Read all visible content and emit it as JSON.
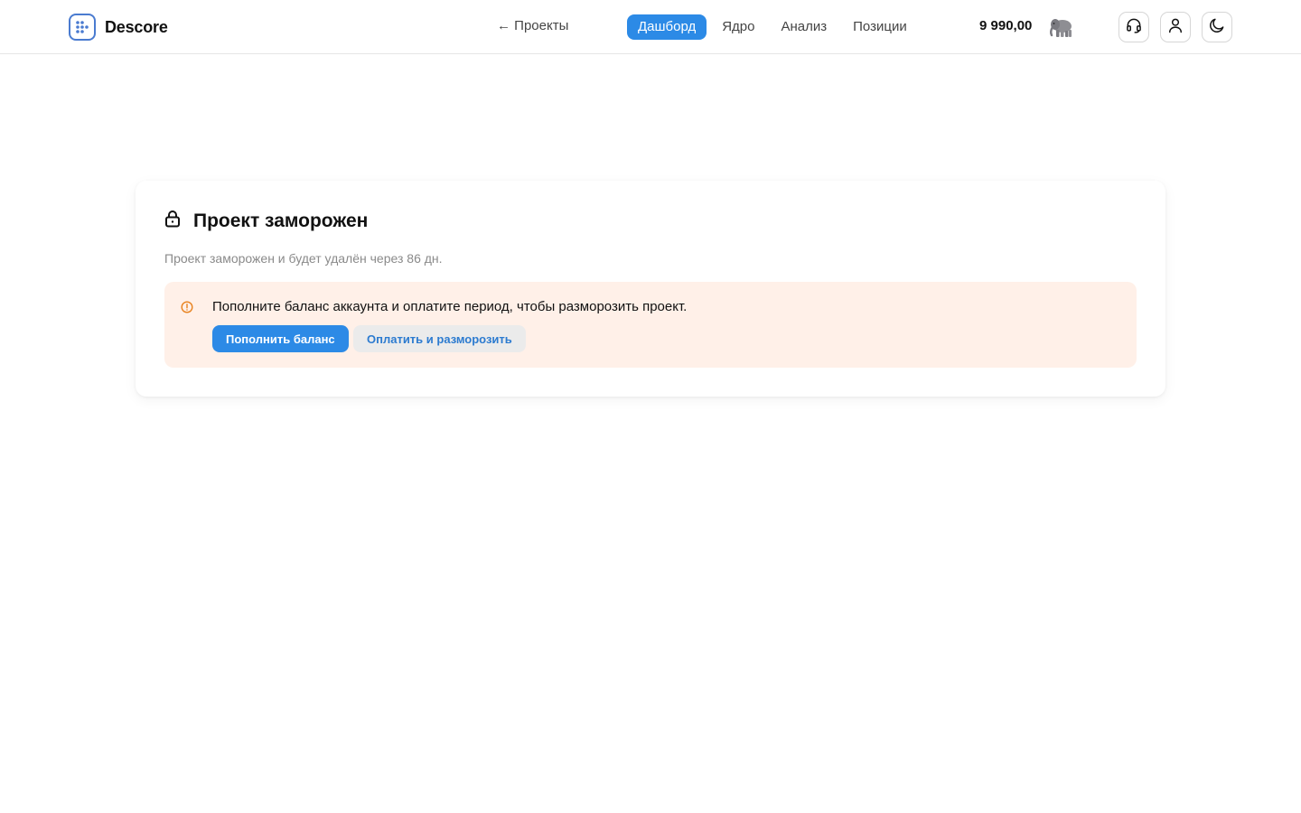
{
  "header": {
    "logo_text": "Descore",
    "back_link": "← Проекты",
    "nav": [
      {
        "label": "Дашборд",
        "active": true
      },
      {
        "label": "Ядро",
        "active": false
      },
      {
        "label": "Анализ",
        "active": false
      },
      {
        "label": "Позиции",
        "active": false
      }
    ],
    "balance": "9 990,00",
    "mascot_icon": "elephant-icon",
    "icons": [
      "headset-icon",
      "user-icon",
      "moon-icon"
    ]
  },
  "card": {
    "title": "Проект заморожен",
    "title_icon": "lock-icon",
    "subtitle": "Проект заморожен и будет удалён через 86 дн.",
    "alert": {
      "icon": "warning-icon",
      "text": "Пополните баланс аккаунта и оплатите период, чтобы разморозить проект.",
      "primary_button": "Пополнить баланс",
      "secondary_button": "Оплатить и разморозить"
    }
  },
  "colors": {
    "accent": "#2c8ae6",
    "alert_bg": "#fff0e8",
    "warning": "#e8821e"
  }
}
